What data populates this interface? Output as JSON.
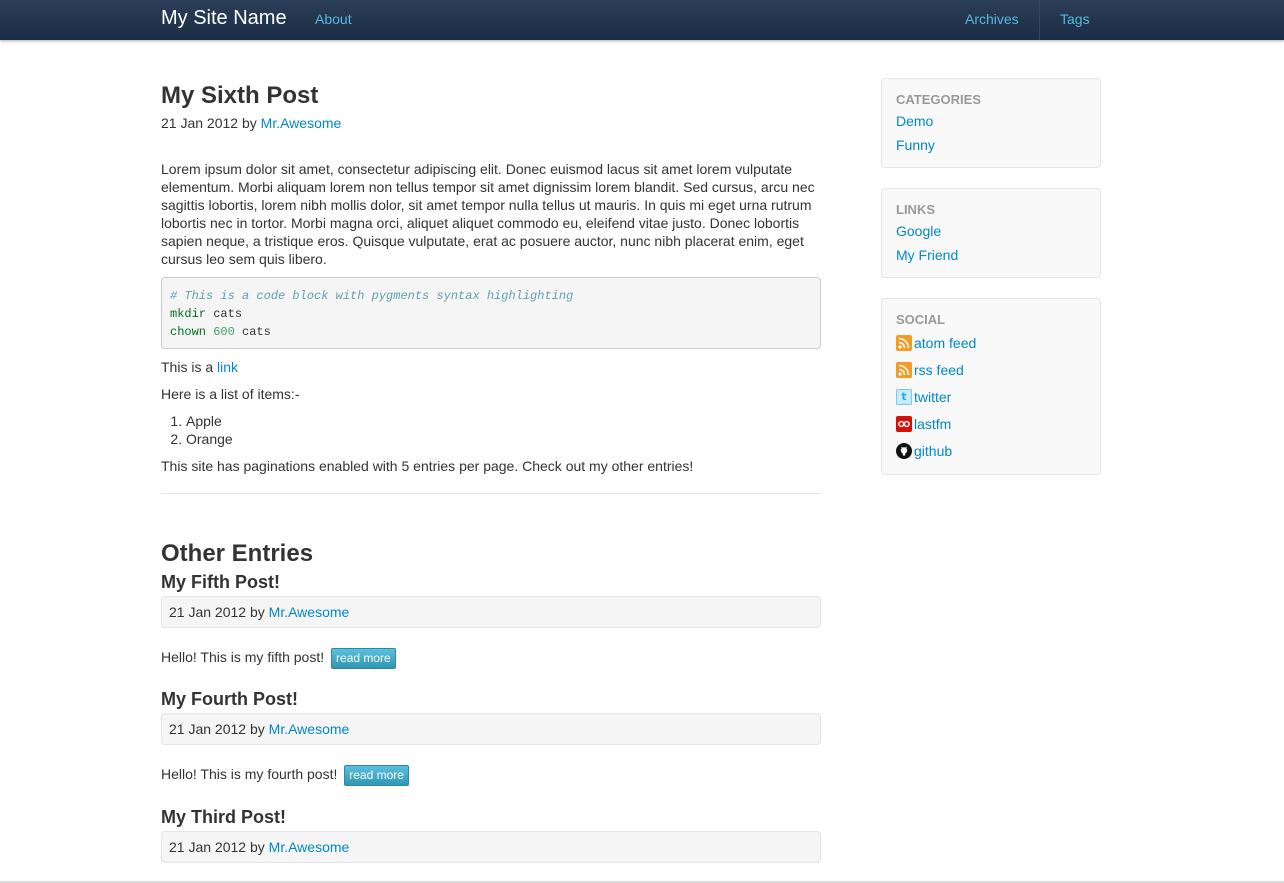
{
  "navbar": {
    "brand": "My Site Name",
    "about": "About",
    "archives": "Archives",
    "tags": "Tags"
  },
  "post": {
    "title": "My Sixth Post",
    "date": "21 Jan 2012",
    "by": "by",
    "author": "Mr.Awesome",
    "body": "Lorem ipsum dolor sit amet, consectetur adipiscing elit. Donec euismod lacus sit amet lorem vulputate elementum. Morbi aliquam lorem non tellus tempor sit amet dignissim lorem blandit. Sed cursus, arcu nec sagittis lobortis, lorem nibh mollis dolor, sit amet tempor nulla tellus ut mauris. In quis mi eget urna rutrum lobortis nec in tortor. Morbi magna orci, aliquet aliquet commodo eu, eleifend vitae justo. Donec lobortis sapien neque, a tristique eros. Quisque vulputate, erat ac posuere auctor, nunc nibh placerat enim, eget cursus leo sem quis libero.",
    "code": {
      "comment": "# This is a code block with pygments syntax highlighting",
      "line1_cmd": "mkdir",
      "line1_arg": " cats",
      "line2_cmd": "chown",
      "line2_num": "600",
      "line2_arg": " cats"
    },
    "link_prefix": "This is a ",
    "link_text": "link",
    "list_intro": "Here is a list of items:-",
    "list_items": [
      "Apple",
      "Orange"
    ],
    "pagination_note": "This site has paginations enabled with 5 entries per page. Check out my other entries!"
  },
  "other_entries": {
    "heading": "Other Entries",
    "read_more": "read more",
    "entries": [
      {
        "title": "My Fifth Post!",
        "date": "21 Jan 2012",
        "by": "by",
        "author": "Mr.Awesome",
        "summary": "Hello! This is my fifth post!"
      },
      {
        "title": "My Fourth Post!",
        "date": "21 Jan 2012",
        "by": "by",
        "author": "Mr.Awesome",
        "summary": "Hello! This is my fourth post!"
      },
      {
        "title": "My Third Post!",
        "date": "21 Jan 2012",
        "by": "by",
        "author": "Mr.Awesome"
      }
    ]
  },
  "sidebar": {
    "categories": {
      "header": "Categories",
      "items": [
        "Demo",
        "Funny"
      ]
    },
    "links": {
      "header": "Links",
      "items": [
        "Google",
        "My Friend"
      ]
    },
    "social": {
      "header": "Social",
      "items": [
        {
          "label": "atom feed",
          "icon": "atom-feed-icon"
        },
        {
          "label": "rss feed",
          "icon": "rss-feed-icon"
        },
        {
          "label": "twitter",
          "icon": "twitter-icon"
        },
        {
          "label": "lastfm",
          "icon": "lastfm-icon"
        },
        {
          "label": "github",
          "icon": "github-icon"
        }
      ]
    }
  },
  "colors": {
    "navbar": "#1f3048",
    "link": "#0088cc",
    "nav_link": "#56b6e0",
    "button": "#49afcd"
  }
}
